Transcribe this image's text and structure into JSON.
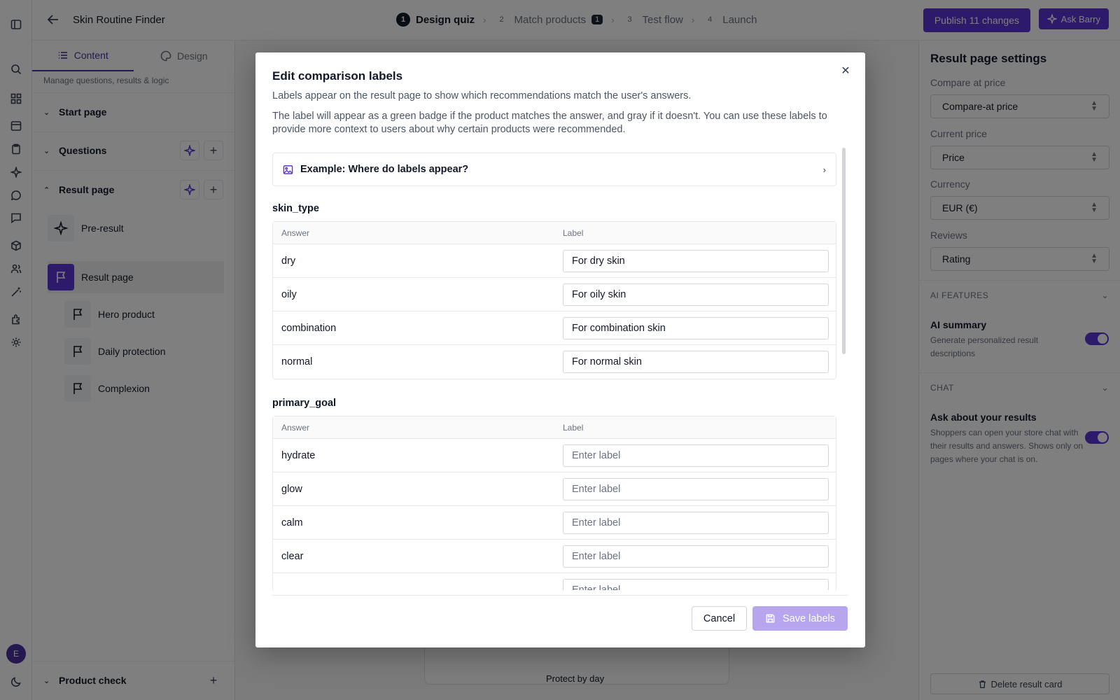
{
  "app": {
    "title": "Skin Routine Finder",
    "avatar_initial": "E",
    "accent_color": "#5b35d5"
  },
  "steps": [
    {
      "num": "1",
      "label": "Design quiz",
      "active": true
    },
    {
      "num": "2",
      "label": "Match products",
      "badge": "1"
    },
    {
      "num": "3",
      "label": "Test flow"
    },
    {
      "num": "4",
      "label": "Launch"
    }
  ],
  "topbar": {
    "publish_label": "Publish 11 changes",
    "ask_label": "Ask Barry"
  },
  "sidebar": {
    "tabs": [
      {
        "label": "Content",
        "icon": "list-icon"
      },
      {
        "label": "Design",
        "icon": "palette-icon"
      }
    ],
    "subtitle": "Manage questions, results & logic",
    "sections": {
      "start": "Start page",
      "questions": "Questions",
      "result": "Result page",
      "product_check": "Product check"
    },
    "result_items": [
      "Pre-result",
      "Result page",
      "Hero product",
      "Daily protection",
      "Complexion"
    ]
  },
  "canvas": {
    "caption": "Protect by day"
  },
  "right_panel": {
    "title": "Result page settings",
    "fields": [
      {
        "label": "Compare at price",
        "value": "Compare-at price"
      },
      {
        "label": "Current price",
        "value": "Price"
      },
      {
        "label": "Currency",
        "value": "EUR (€)"
      },
      {
        "label": "Reviews",
        "value": "Rating"
      }
    ],
    "ai_section": "AI FEATURES",
    "ai_summary_title": "AI summary",
    "ai_summary_desc": "Generate personalized result descriptions",
    "chat_section": "CHAT",
    "chat_title": "Ask about your results",
    "chat_desc": "Shoppers can open your store chat with their results and answers. Shows only on pages where your chat is on.",
    "delete_label": "Delete result card"
  },
  "modal": {
    "title": "Edit comparison labels",
    "desc1": "Labels appear on the result page to show which recommendations match the user's answers.",
    "desc2": "The label will appear as a green badge if the product matches the answer, and gray if it doesn't. You can use these labels to provide more context to users about why certain products were recommended.",
    "example_label": "Example: Where do labels appear?",
    "col_answer": "Answer",
    "col_label": "Label",
    "placeholder": "Enter label",
    "groups": [
      {
        "name": "skin_type",
        "rows": [
          {
            "answer": "dry",
            "label": "For dry skin"
          },
          {
            "answer": "oily",
            "label": "For oily skin"
          },
          {
            "answer": "combination",
            "label": "For combination skin"
          },
          {
            "answer": "normal",
            "label": "For normal skin"
          }
        ]
      },
      {
        "name": "primary_goal",
        "rows": [
          {
            "answer": "hydrate",
            "label": ""
          },
          {
            "answer": "glow",
            "label": ""
          },
          {
            "answer": "calm",
            "label": ""
          },
          {
            "answer": "clear",
            "label": ""
          },
          {
            "answer": "",
            "label": ""
          }
        ]
      }
    ],
    "cancel_label": "Cancel",
    "save_label": "Save labels"
  }
}
